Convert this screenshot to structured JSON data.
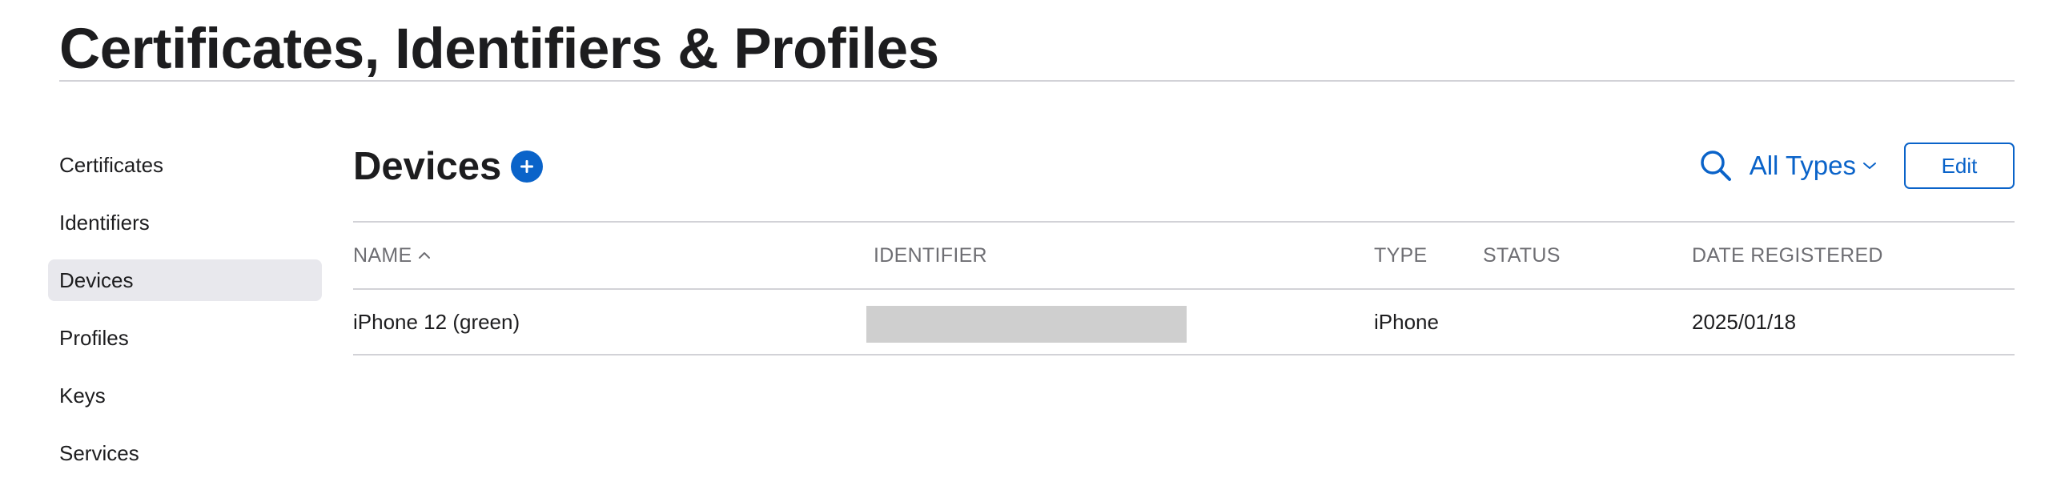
{
  "page": {
    "title": "Certificates, Identifiers & Profiles"
  },
  "sidebar": {
    "items": [
      {
        "label": "Certificates",
        "active": false
      },
      {
        "label": "Identifiers",
        "active": false
      },
      {
        "label": "Devices",
        "active": true
      },
      {
        "label": "Profiles",
        "active": false
      },
      {
        "label": "Keys",
        "active": false
      },
      {
        "label": "Services",
        "active": false
      }
    ]
  },
  "section": {
    "title": "Devices",
    "add_icon": "plus-circle-icon"
  },
  "toolbar": {
    "search_icon": "search-icon",
    "filter_label": "All Types",
    "filter_icon": "chevron-down-icon",
    "edit_label": "Edit"
  },
  "table": {
    "columns": [
      "NAME",
      "IDENTIFIER",
      "TYPE",
      "STATUS",
      "DATE REGISTERED"
    ],
    "sort": {
      "column": "NAME",
      "direction": "ascending"
    },
    "rows": [
      {
        "name": "iPhone 12 (green)",
        "identifier": "",
        "identifier_redacted": true,
        "type": "iPhone",
        "status": "",
        "date_registered": "2025/01/18"
      }
    ]
  },
  "colors": {
    "accent": "#0a63c9",
    "text": "#1d1d1f",
    "muted": "#6e6e73",
    "divider": "#d2d2d7",
    "active_bg": "#e8e8ed",
    "redaction": "#cfcfcf"
  }
}
